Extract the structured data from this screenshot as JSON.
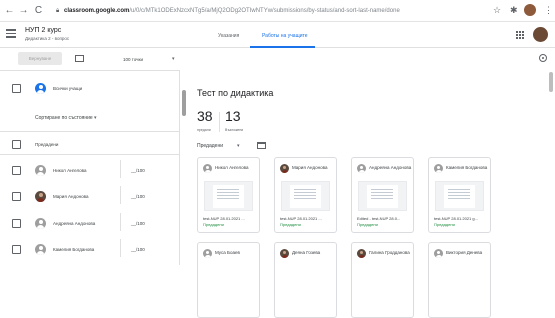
{
  "browser": {
    "url_host": "classroom.google.com",
    "url_path": "/u/0/c/MTk1ODExNzcxNTg5/a/MjQ2ODg2OTIwNTYw/submissions/by-status/and-sort-last-name/done",
    "back_glyph": "←",
    "forward_glyph": "→",
    "reload_glyph": "C",
    "star_glyph": "☆",
    "menu_glyph": "⋮",
    "ext_glyph": "✱"
  },
  "header": {
    "course_title": "НУП 2 курс",
    "course_subtitle": "Дидактика 2 - вопрос",
    "tabs": [
      {
        "label": "Указания"
      },
      {
        "label": "Работы на учащите"
      }
    ]
  },
  "toolbar": {
    "return_label": "Вернуване",
    "points_label": "100 точки",
    "dropdown_glyph": "▾"
  },
  "students": {
    "all_label": "Всички учащи",
    "sort_label": "Сортиране по състояние",
    "sort_glyph": "▾",
    "group_label": "Предадени",
    "list": [
      {
        "name": "Никол Ангелова",
        "grade": "__/100"
      },
      {
        "name": "Мария Андонова",
        "grade": "__/100"
      },
      {
        "name": "Андреяна Андонова",
        "grade": "__/100"
      },
      {
        "name": "Камелия Богданова",
        "grade": "__/100"
      }
    ]
  },
  "assignment": {
    "title": "Тест по дидактика",
    "stats": [
      {
        "value": "38",
        "label": "предали"
      },
      {
        "value": "13",
        "label": "Възложени"
      }
    ],
    "filter_label": "Предадени",
    "filter_glyph": "▾",
    "cards": [
      {
        "name": "Никол Ангелова",
        "file": "test-NUP 28.01.2021 ...",
        "status": "Предадени"
      },
      {
        "name": "Мария Андонова",
        "file": "test-NUP 28.01.2021 ...",
        "status": "Предадени"
      },
      {
        "name": "Андреяна Андонова",
        "file": "Edited - test-NUP 28.0...",
        "status": "Предадени"
      },
      {
        "name": "Камелия Богданова",
        "file": "test-NUP 28.01.2021 g...",
        "status": "Предадени"
      },
      {
        "name": "Муса Боаев",
        "file": "",
        "status": ""
      },
      {
        "name": "Деяна Гозева",
        "file": "",
        "status": ""
      },
      {
        "name": "Галина Гродданова",
        "file": "",
        "status": ""
      },
      {
        "name": "Виктория Денева",
        "file": "",
        "status": ""
      }
    ]
  },
  "colors": {
    "accent": "#1a73e8",
    "status_green": "#1e8e3e"
  }
}
